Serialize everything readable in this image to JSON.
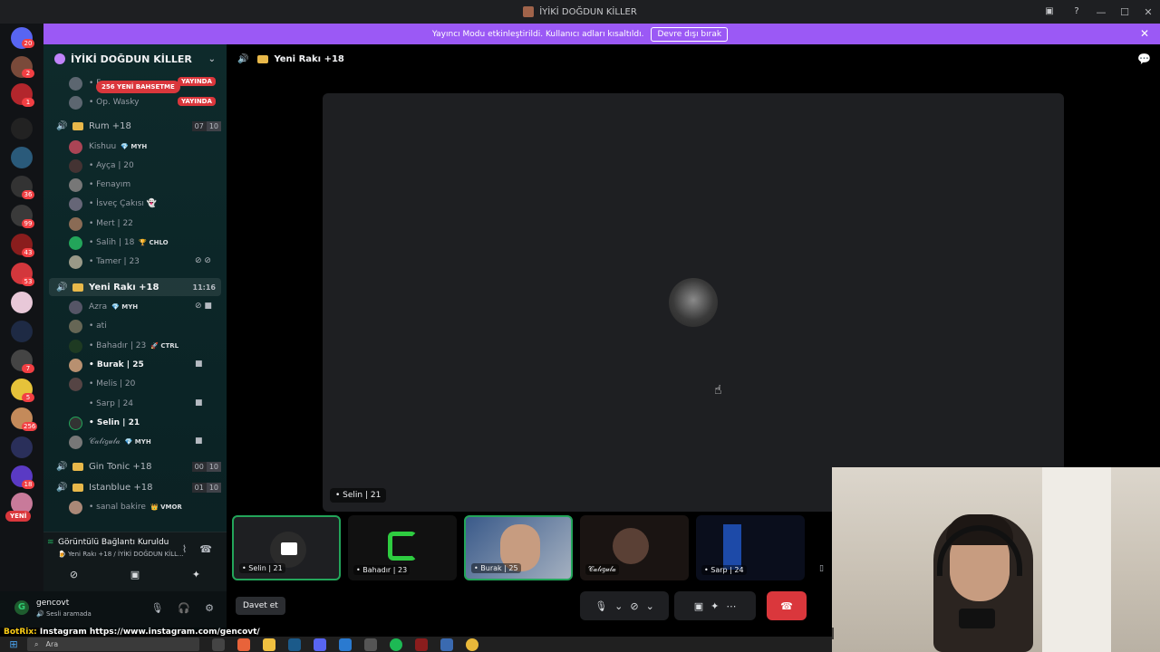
{
  "window": {
    "title": "İYİKİ DOĞDUN KİLLER"
  },
  "banner": {
    "text": "Yayıncı Modu etkinleştirildi. Kullanıcı adları kısaltıldı.",
    "button": "Devre dışı bırak"
  },
  "rail": {
    "badges": [
      "20",
      "2",
      "1",
      "36",
      "99",
      "43",
      "53",
      "7",
      "5",
      "256",
      "18"
    ],
    "yeni_pill": "YENİ"
  },
  "guild": {
    "name": "İYİKİ DOĞDUN KİLLER"
  },
  "mention_pill": "256 YENİ BAHSETME",
  "live_label": "YAYINDA",
  "channels": [
    {
      "name": "Rum +18",
      "counts": [
        "07",
        "10"
      ]
    },
    {
      "name": "Yeni Rakı +18",
      "time": "11:16"
    },
    {
      "name": "Gin Tonic +18",
      "counts": [
        "00",
        "10"
      ]
    },
    {
      "name": "Istanblue +18",
      "counts": [
        "01",
        "10"
      ]
    }
  ],
  "users_top": [
    {
      "name": "• F"
    },
    {
      "name": "• Op. Wasky"
    }
  ],
  "users_rum": [
    {
      "name": "Kishuu",
      "tag": "💎 MYH"
    },
    {
      "name": "• Ayça | 20"
    },
    {
      "name": "• Fenayım"
    },
    {
      "name": "• İsveç Çakısı 👻"
    },
    {
      "name": "• Mert | 22"
    },
    {
      "name": "• Salih | 18",
      "tag": "🏆 CHLO"
    },
    {
      "name": "• Tamer | 23"
    }
  ],
  "users_yeni": [
    {
      "name": "Azra",
      "tag": "💎 MYH"
    },
    {
      "name": "• ati"
    },
    {
      "name": "• Bahadır | 23",
      "tag": "🚀 CTRL"
    },
    {
      "name": "• Burak | 25"
    },
    {
      "name": "• Melis | 20"
    },
    {
      "name": "• Sarp | 24"
    },
    {
      "name": "• Selin | 21"
    },
    {
      "name": "𝒞𝒶𝓁𝒾𝑔𝓊𝓁𝒶",
      "tag": "💎 MYH"
    }
  ],
  "users_istanblue": [
    {
      "name": "• sanal bakire",
      "tag": "👑 VMOR"
    }
  ],
  "voice_panel": {
    "title": "Görüntülü Bağlantı Kuruldu",
    "subtitle": "🍺 Yeni Rakı +18 / İYİKİ DOĞDUN KİLL..."
  },
  "user_panel": {
    "name": "gencovt",
    "status": "🔊 Sesli aramada"
  },
  "main": {
    "channel_title": "Yeni Rakı +18",
    "stage_label": "• Selin | 21"
  },
  "tiles": [
    {
      "label": "• Selin | 21"
    },
    {
      "label": "• Bahadır | 23"
    },
    {
      "label": "• Burak | 25"
    },
    {
      "label": "𝒞𝒶𝓁𝒾𝑔𝓊𝓁𝒶"
    },
    {
      "label": "• Sarp | 24"
    }
  ],
  "bottom": {
    "invite": "Davet et"
  },
  "overlay": {
    "prefix": "BotRix:",
    "text": " Instagram https://www.instagram.com/gencovt/"
  },
  "taskbar": {
    "search_placeholder": "Ara"
  },
  "colors": {
    "accent": "#9b59f5",
    "danger": "#da373c",
    "online": "#23a55a"
  }
}
